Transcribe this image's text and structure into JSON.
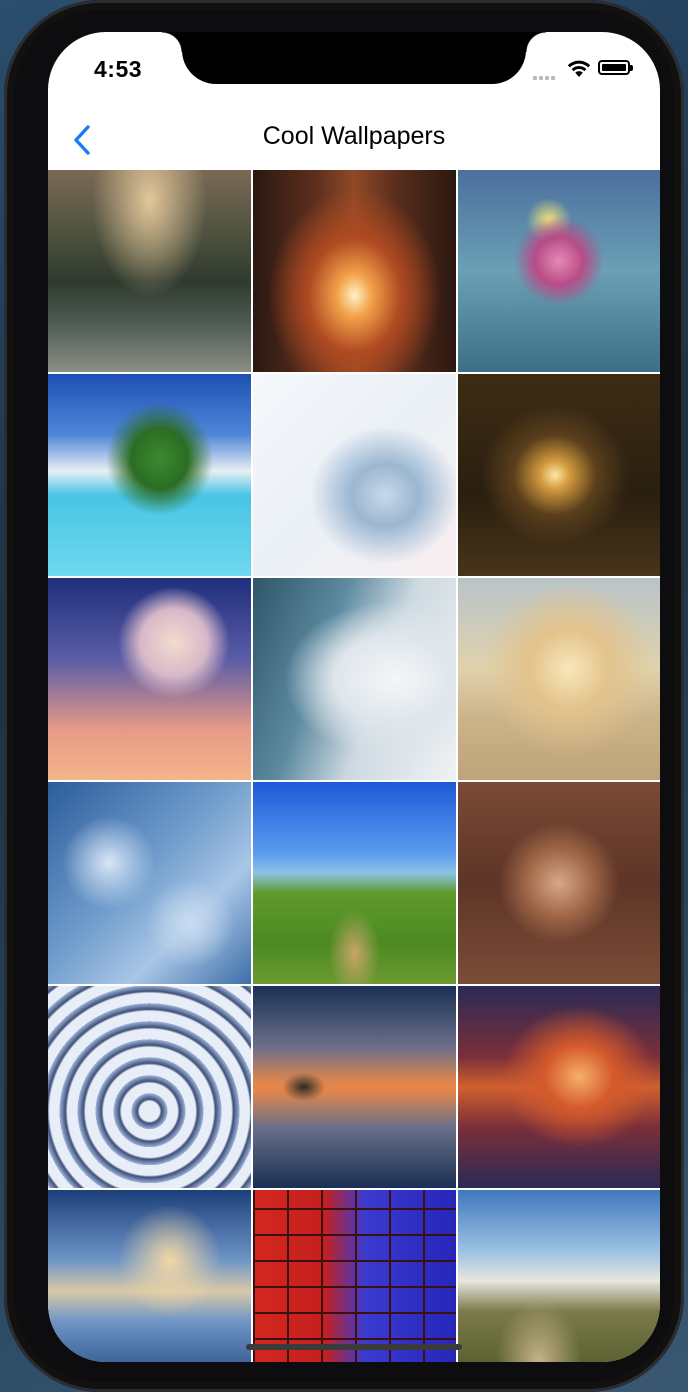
{
  "status_bar": {
    "time": "4:53"
  },
  "nav": {
    "title": "Cool Wallpapers",
    "back_icon": "chevron-left-icon"
  },
  "accent_color": "#1a7cf5",
  "wallpapers": [
    {
      "name": "wallpaper-mountain-lake-island",
      "bg": "radial-gradient(ellipse at 50% 15%, #e2c79a 0%, transparent 40%), linear-gradient(180deg,#7a6a55 0%,#4a4f3c 35%,#2f3a2e 55%,#4d5a52 75%,#8a8e86 100%)"
    },
    {
      "name": "wallpaper-forest-path-light",
      "bg": "radial-gradient(ellipse at 50% 62%, #fff2c4 0%, #f3a24a 12%, #b04a22 32%, transparent 60%), linear-gradient(90deg,#2a1812 0%,#5b2e1c 30%,#8e4a27 50%,#5b2e1c 70%,#2a1812 100%)"
    },
    {
      "name": "wallpaper-pink-rose",
      "bg": "radial-gradient(circle at 50% 45%, #e58ab4 0%, #b74c87 16%, transparent 30%), radial-gradient(circle at 45% 25%, #f2e37a 0%, transparent 12%), linear-gradient(180deg,#4c6f9c 0%,#6aa0b6 50%,#3d6f86 100%)"
    },
    {
      "name": "wallpaper-tropical-island",
      "bg": "radial-gradient(ellipse at 55% 42%, #3a8a2e 0%, #2b6d24 18%, transparent 34%), linear-gradient(180deg,#1d4fb3 0%,#4f87d8 30%,#e8eef4 48%,#48c4e5 60%,#6fd8ee 100%)"
    },
    {
      "name": "wallpaper-white-feather",
      "bg": "radial-gradient(ellipse at 65% 60%, #c9d8e8 0%, #9bb7d2 18%, transparent 40%), linear-gradient(135deg,#f6f8fb 0%,#eaf0f6 50%,#f8eef0 100%)"
    },
    {
      "name": "wallpaper-glowing-tunnel",
      "bg": "radial-gradient(ellipse at 48% 50%, #ffe7a6 0%, #d29a3d 10%, #5a3f1c 28%, transparent 50%), linear-gradient(180deg,#3c2c14 0%,#2a1f10 60%,#48341a 100%)"
    },
    {
      "name": "wallpaper-sky-lantern-boy",
      "bg": "radial-gradient(circle at 62% 32%, #f3dccf 0%, #d7b8c8 18%, transparent 30%), linear-gradient(180deg,#1f2f7c 0%,#5a5ca6 40%,#e79a87 75%,#f4b58a 100%)"
    },
    {
      "name": "wallpaper-waterfall-mist",
      "bg": "radial-gradient(ellipse at 70% 50%, #f4f6f8 0%, #dfe6ec 30%, transparent 55%), linear-gradient(110deg,#2f5569 0%,#5d8aa0 35%,#cdd9e1 60%,#f0f2f4 100%)"
    },
    {
      "name": "wallpaper-fisherman-boat",
      "bg": "radial-gradient(ellipse at 55% 45%, #f9e7bb 0%, #e3c38c 25%, transparent 55%), linear-gradient(180deg,#b9c4c8 0%,#e0d2ad 45%,#cbb288 70%,#bfa37a 100%)"
    },
    {
      "name": "wallpaper-water-bubbles",
      "bg": "radial-gradient(circle at 30% 40%, #d7e6f6 0%, transparent 25%), radial-gradient(circle at 70% 70%, #c9dcf0 0%, transparent 22%), linear-gradient(135deg,#2c5d9b 0%,#6f9ccc 45%,#a9c6e6 70%,#3e6ea8 100%)"
    },
    {
      "name": "wallpaper-green-hill-road",
      "bg": "radial-gradient(ellipse at 50% 85%, #c9a56a 0%, transparent 18%), linear-gradient(180deg,#1d5ad6 0%,#5b9bf0 35%,#8cc3e6 45%,#5f9a2a 55%,#4c8a22 80%,#6b9a30 100%)"
    },
    {
      "name": "wallpaper-man-fur-hat",
      "bg": "radial-gradient(ellipse at 50% 50%, #d7a88a 0%, #a36a4a 22%, transparent 42%), linear-gradient(180deg,#7a4a36 0%,#5e3526 50%,#7b4c38 100%)"
    },
    {
      "name": "wallpaper-water-ripple",
      "bg": "repeating-radial-gradient(circle at 50% 62%, #e8eef8 0px, #e8eef8 10px, #3e4f78 12px, #9eb3d8 18px), linear-gradient(180deg,#c7d3ee 0%,#6f84b4 100%)"
    },
    {
      "name": "wallpaper-sunset-reflection",
      "bg": "radial-gradient(ellipse at 25% 50%, #2a2a2a 0%, transparent 10%), linear-gradient(180deg,#1a2f55 0%,#6a6f8a 30%,#e2864a 48%,#e2864a 52%,#6a6f8a 70%,#1a2f55 100%)"
    },
    {
      "name": "wallpaper-lighthouse-sunset",
      "bg": "radial-gradient(ellipse at 60% 45%, #f7b06a 0%, #d45a2c 20%, transparent 45%), linear-gradient(180deg,#2b2a55 0%,#7a2f3a 35%,#d0602e 50%,#7a2f3a 70%,#2b2a55 100%)"
    },
    {
      "name": "wallpaper-cloud-reflection",
      "bg": "radial-gradient(ellipse at 60% 35%, #f2d7a5 0%, transparent 30%), linear-gradient(180deg,#1c3f7a 0%,#6f96c7 35%,#d9c9a8 50%,#6f96c7 65%,#1c3f7a 100%)"
    },
    {
      "name": "wallpaper-red-blue-brick-wall",
      "bg": "repeating-linear-gradient(0deg,#3a1010 0px,#3a1010 2px,transparent 2px,transparent 26px), repeating-linear-gradient(90deg,#3a1010 0px,#3a1010 2px,transparent 2px,transparent 34px), linear-gradient(90deg,#d3271f 0%,#c5201e 35%,#3a3ad0 55%,#2626b8 100%)"
    },
    {
      "name": "wallpaper-mountain-valley-goat",
      "bg": "radial-gradient(ellipse at 40% 85%, #c8b48a 0%, transparent 25%), linear-gradient(180deg,#3f78bd 0%,#9cc1e2 30%,#e8e6df 45%,#7d7a4a 60%,#5b6232 85%,#7e6d45 100%)"
    }
  ]
}
